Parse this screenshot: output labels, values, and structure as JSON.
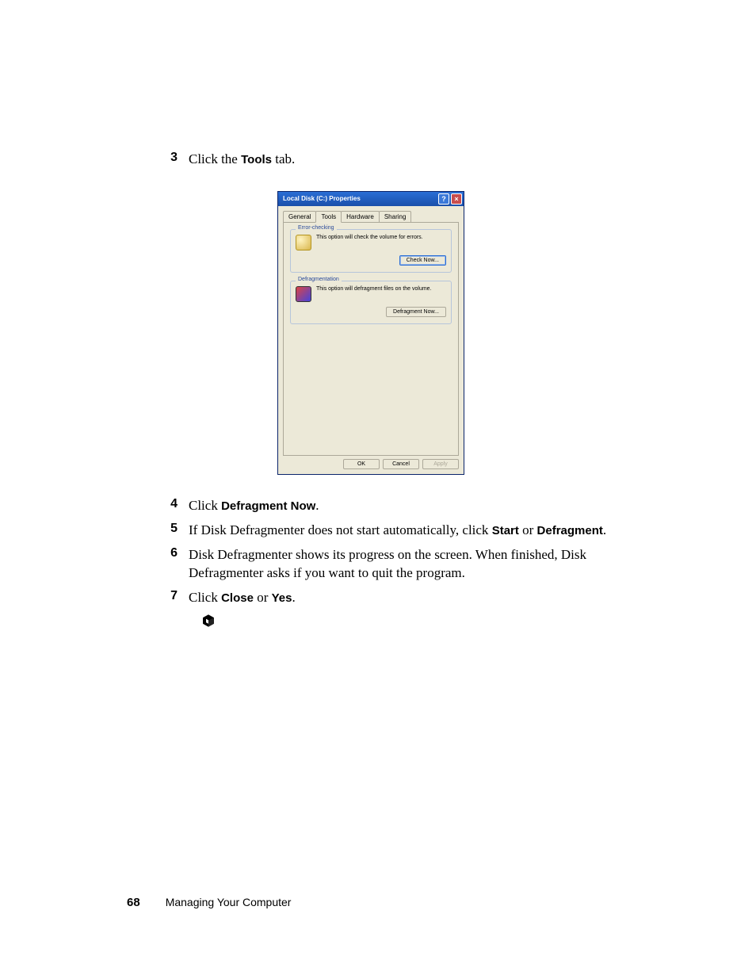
{
  "steps": {
    "3_num": "3",
    "3_text_a": "Click the ",
    "3_bold": "Tools",
    "3_text_b": " tab.",
    "4_num": "4",
    "4_text_a": "Click ",
    "4_bold": "Defragment Now",
    "4_text_b": ".",
    "5_num": "5",
    "5_text_a": "If Disk Defragmenter does not start automatically, click ",
    "5_bold_a": "Start",
    "5_text_b": " or ",
    "5_bold_b": "Defragment",
    "5_text_c": ".",
    "6_num": "6",
    "6_text": "Disk Defragmenter shows its progress on the screen. When finished, Disk Defragmenter asks if you want to quit the program.",
    "7_num": "7",
    "7_text_a": "Click ",
    "7_bold_a": "Close",
    "7_text_b": " or ",
    "7_bold_b": "Yes",
    "7_text_c": "."
  },
  "dialog": {
    "title": "Local Disk (C:) Properties",
    "tabs": {
      "general": "General",
      "tools": "Tools",
      "hardware": "Hardware",
      "sharing": "Sharing"
    },
    "error_checking": {
      "title": "Error-checking",
      "text": "This option will check the volume for errors.",
      "button": "Check Now..."
    },
    "defragmentation": {
      "title": "Defragmentation",
      "text": "This option will defragment files on the volume.",
      "button": "Defragment Now..."
    },
    "footer": {
      "ok": "OK",
      "cancel": "Cancel",
      "apply": "Apply"
    }
  },
  "footer": {
    "page_number": "68",
    "section_title": "Managing Your Computer"
  }
}
